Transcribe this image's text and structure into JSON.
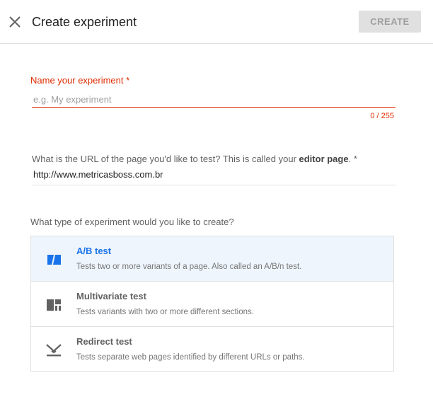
{
  "header": {
    "title": "Create experiment",
    "create_label": "CREATE",
    "close_icon": "close-icon"
  },
  "name_field": {
    "label": "Name your experiment *",
    "placeholder": "e.g. My experiment",
    "value": "",
    "counter": "0 / 255"
  },
  "url_field": {
    "label_prefix": "What is the URL of the page you'd like to test? This is called your ",
    "label_bold": "editor page",
    "label_suffix": ". *",
    "value": "http://www.metricasboss.com.br"
  },
  "type_section": {
    "label": "What type of experiment would you like to create?",
    "options": [
      {
        "title": "A/B test",
        "description": "Tests two or more variants of a page. Also called an A/B/n test.",
        "icon": "ab-test-icon",
        "selected": true
      },
      {
        "title": "Multivariate test",
        "description": "Tests variants with two or more different sections.",
        "icon": "multivariate-test-icon",
        "selected": false
      },
      {
        "title": "Redirect test",
        "description": "Tests separate web pages identified by different URLs or paths.",
        "icon": "redirect-test-icon",
        "selected": false
      }
    ]
  },
  "colors": {
    "error": "#dd2c00",
    "selected_bg": "#eef5fd",
    "selected_text": "#1a73e8",
    "icon_selected": "#1a73e8",
    "icon_default": "#616161"
  }
}
